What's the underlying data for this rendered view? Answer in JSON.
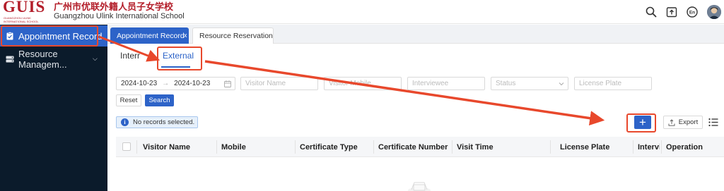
{
  "header": {
    "logo_text": "GUIS",
    "logo_sub1": "GUANGZHOU ULINK",
    "logo_sub2": "INTERNATIONAL SCHOOL",
    "school_name_cn": "广州市优联外籍人员子女学校",
    "school_name_en": "Guangzhou Ulink International School",
    "icons": [
      "search-icon",
      "upload-icon",
      "language-icon",
      "avatar"
    ]
  },
  "sidebar": {
    "items": [
      {
        "label": "Appointment Record",
        "icon": "clipboard-icon",
        "active": true
      },
      {
        "label": "Resource Managem...",
        "icon": "server-icon",
        "active": false,
        "has_submenu": true
      }
    ]
  },
  "page_tabs": [
    {
      "label": "Appointment Record",
      "active": true,
      "close": "x"
    },
    {
      "label": "Resource Reservation",
      "active": false
    }
  ],
  "sub_tabs": [
    {
      "label": "Interr",
      "active": false
    },
    {
      "label": "External",
      "active": true
    }
  ],
  "filters": {
    "date_start": "2024-10-23",
    "date_arrow": "→",
    "date_end": "2024-10-23",
    "visitor_name_placeholder": "Visitor Name",
    "visitor_mobile_placeholder": "Visitor Mobile",
    "interviewee_placeholder": "Interviewee",
    "status_placeholder": "Status",
    "license_plate_placeholder": "License Plate",
    "reset_label": "Reset",
    "search_label": "Search"
  },
  "toolbar": {
    "selection_text": "No records selected.",
    "add_label": "+",
    "export_label": "Export"
  },
  "table": {
    "columns": [
      "Visitor Name",
      "Mobile",
      "Certificate Type",
      "Certificate Number",
      "Visit Time",
      "License Plate",
      "Intervi",
      "Operation"
    ],
    "rows": []
  },
  "colors": {
    "brand_red": "#b31e2a",
    "primary_blue": "#2d63c8",
    "sidebar_bg": "#0b1b2b",
    "annotation_red": "#e8482c"
  }
}
